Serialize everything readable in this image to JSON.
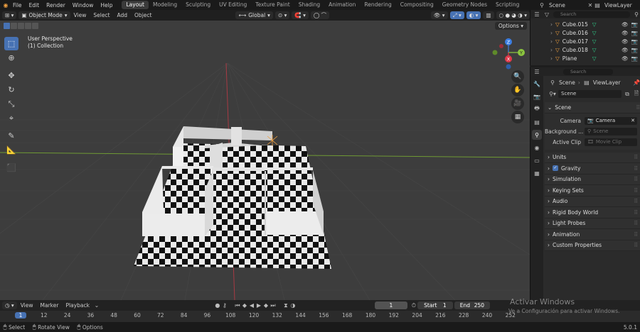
{
  "app": {
    "menus": [
      "File",
      "Edit",
      "Render",
      "Window",
      "Help"
    ],
    "workspaces": [
      "Layout",
      "Modeling",
      "Sculpting",
      "UV Editing",
      "Texture Paint",
      "Shading",
      "Animation",
      "Rendering",
      "Compositing",
      "Geometry Nodes",
      "Scripting"
    ],
    "active_workspace": "Layout",
    "scene": "Scene",
    "view_layer": "ViewLayer",
    "version": "5.0.1"
  },
  "viewport_header": {
    "mode": "Object Mode",
    "menus": [
      "View",
      "Select",
      "Add",
      "Object"
    ],
    "orientation": "Global",
    "options_label": "Options"
  },
  "viewport": {
    "perspective_label": "User Perspective",
    "collection_label": "(1) Collection",
    "gizmo_axes": {
      "x": "X",
      "y": "Y",
      "z": "Z"
    },
    "axis_colors": {
      "x": "#e0394a",
      "y": "#8bc53f",
      "z": "#3d7fe3"
    }
  },
  "outliner": {
    "search_placeholder": "Search",
    "items": [
      {
        "name": "Cube.015"
      },
      {
        "name": "Cube.016"
      },
      {
        "name": "Cube.017"
      },
      {
        "name": "Cube.018"
      },
      {
        "name": "Plane"
      }
    ]
  },
  "properties": {
    "search_placeholder": "Search",
    "breadcrumb": [
      "Scene",
      "ViewLayer"
    ],
    "scene_name": "Scene",
    "panel_title": "Scene",
    "fields": [
      {
        "label": "Camera",
        "value": "Camera",
        "ghost": false
      },
      {
        "label": "Background ...",
        "value": "Scene",
        "ghost": true
      },
      {
        "label": "Active Clip",
        "value": "Movie Clip",
        "ghost": true
      }
    ],
    "subpanels": [
      "Units",
      "Gravity",
      "Simulation",
      "Keying Sets",
      "Audio",
      "Rigid Body World",
      "Light Probes",
      "Animation",
      "Custom Properties"
    ]
  },
  "timeline": {
    "menus": [
      "View",
      "Marker",
      "Playback"
    ],
    "current_frame": "1",
    "start_label": "Start",
    "start_value": "1",
    "end_label": "End",
    "end_value": "250",
    "ticks": [
      "1",
      "12",
      "24",
      "36",
      "48",
      "60",
      "72",
      "84",
      "96",
      "108",
      "120",
      "132",
      "144",
      "156",
      "168",
      "180",
      "192",
      "204",
      "216",
      "228",
      "240",
      "252"
    ]
  },
  "statusbar": {
    "items": [
      "Select",
      "Rotate View",
      "Options"
    ]
  },
  "watermark": {
    "title": "Activar Windows",
    "subtitle": "Ve a Configuración para activar Windows."
  }
}
